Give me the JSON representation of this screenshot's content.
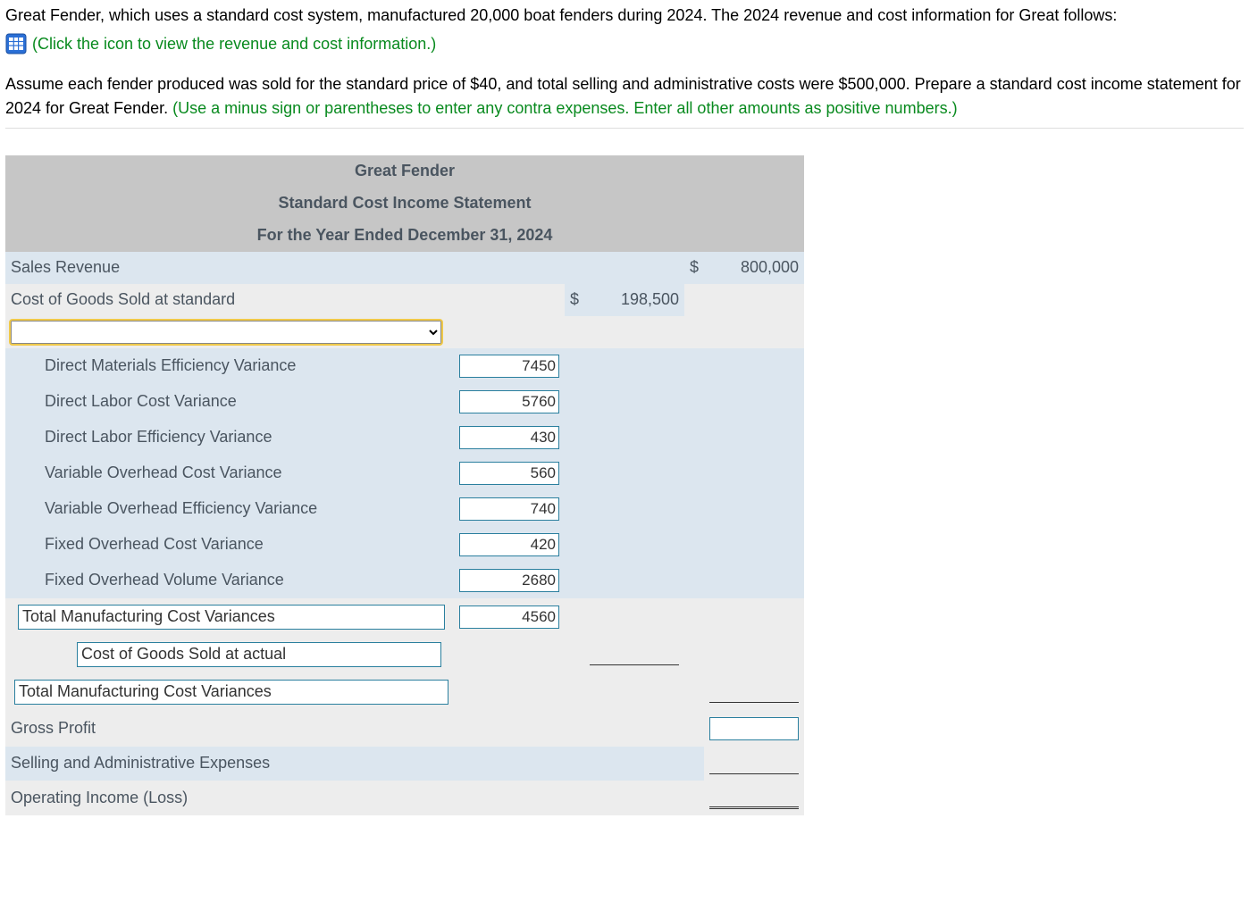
{
  "instructions": {
    "p1": "Great Fender, which uses a standard cost system, manufactured 20,000 boat fenders during 2024. The 2024 revenue and cost information for Great follows:",
    "icon_link": "(Click the icon to view the revenue and cost information.)",
    "p2a": "Assume each fender produced was sold for the standard price of $40, and total selling and administrative costs were $500,000. Prepare a standard cost income statement for 2024 for Great Fender. ",
    "p2b": "(Use a minus sign or parentheses to enter any contra expenses. Enter all other amounts as positive numbers.)"
  },
  "header": {
    "line1": "Great Fender",
    "line2": "Standard Cost Income Statement",
    "line3": "For the Year Ended December 31, 2024"
  },
  "rows": {
    "sales_label": "Sales Revenue",
    "sales_sym": "$",
    "sales_val": "800,000",
    "cogs_label": "Cost of Goods Sold at standard",
    "cogs_sym": "$",
    "cogs_val": "198,500",
    "var1_label": "Direct Materials Efficiency Variance",
    "var1_val": "7450",
    "var2_label": "Direct Labor Cost Variance",
    "var2_val": "5760",
    "var3_label": "Direct Labor Efficiency Variance",
    "var3_val": "430",
    "var4_label": "Variable Overhead Cost Variance",
    "var4_val": "560",
    "var5_label": "Variable Overhead Efficiency Variance",
    "var5_val": "740",
    "var6_label": "Fixed Overhead Cost Variance",
    "var6_val": "420",
    "var7_label": "Fixed Overhead Volume Variance",
    "var7_val": "2680",
    "total_var_input": "Total Manufacturing Cost Variances",
    "total_var_val": "4560",
    "cogs_actual_input": "Cost of Goods Sold at actual",
    "total_var2_input": "Total Manufacturing Cost Variances",
    "gross_profit_label": "Gross Profit",
    "sga_label": "Selling and Administrative Expenses",
    "oi_label": "Operating Income (Loss)"
  }
}
